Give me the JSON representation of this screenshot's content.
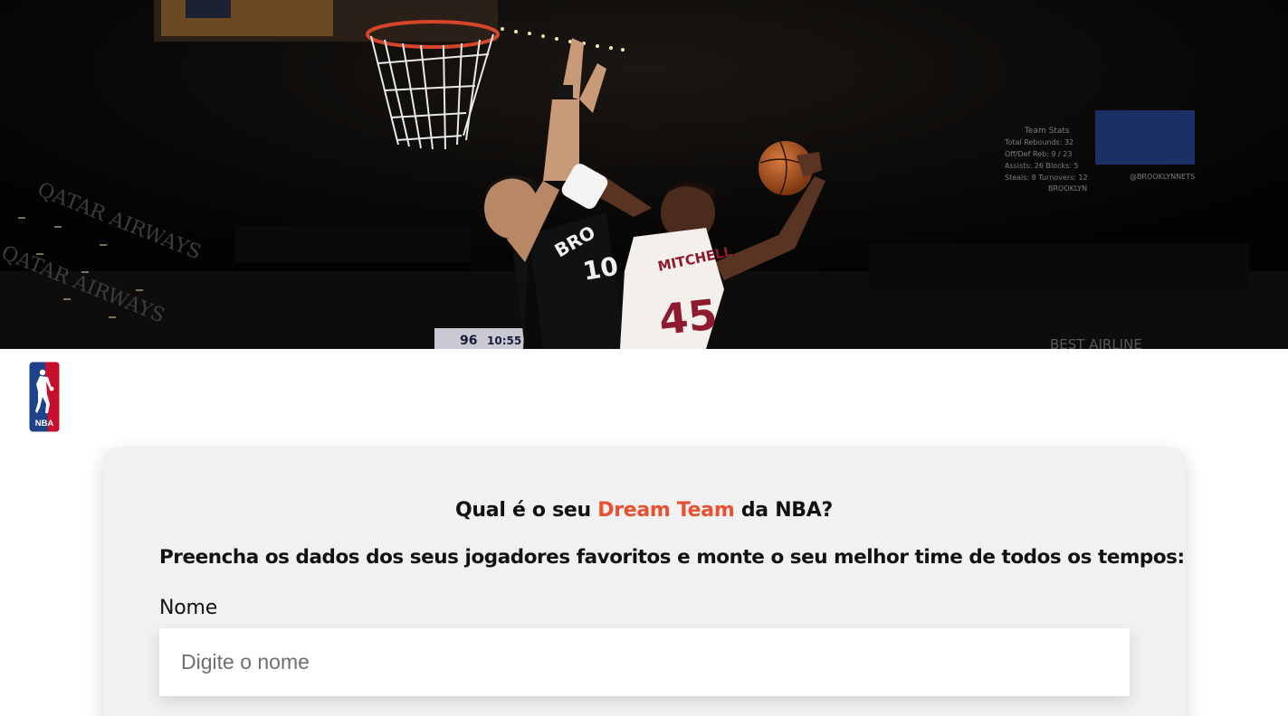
{
  "hero": {
    "arena_ads": [
      "QATAR AIRWAYS",
      "QATAR AIRWAYS"
    ],
    "scoreboard_title": "Team Stats",
    "scoreboard_lines": [
      "Total Rebounds: 32",
      "Off/Def Reb: 9 / 23",
      "Assists: 26    Blocks: 5",
      "Steals: 8     Turnovers: 12"
    ],
    "scoreboard_brand": "BROOKLYN",
    "scoreboard_handle": "@BROOKLYNNETS",
    "score_left": "96",
    "score_clock": "10:55",
    "bottom_ad": "BEST AIRLINE",
    "player_left_jersey": "BRO",
    "player_left_number": "10",
    "player_right_name": "MITCHELL",
    "player_right_number": "45"
  },
  "logo": {
    "text": "NBA",
    "icon": "nba-logo"
  },
  "form": {
    "headline_before": "Qual é o seu ",
    "headline_accent": "Dream Team",
    "headline_after": " da NBA?",
    "subtitle": "Preencha os dados dos seus jogadores favoritos e monte o seu melhor time de todos os tempos:",
    "name_label": "Nome",
    "name_placeholder": "Digite o nome",
    "name_value": ""
  },
  "colors": {
    "accent": "#e8512f",
    "card_bg": "#f1f1f1",
    "nba_blue": "#1d428a",
    "nba_red": "#c8102e",
    "cavs_wine": "#860038"
  }
}
